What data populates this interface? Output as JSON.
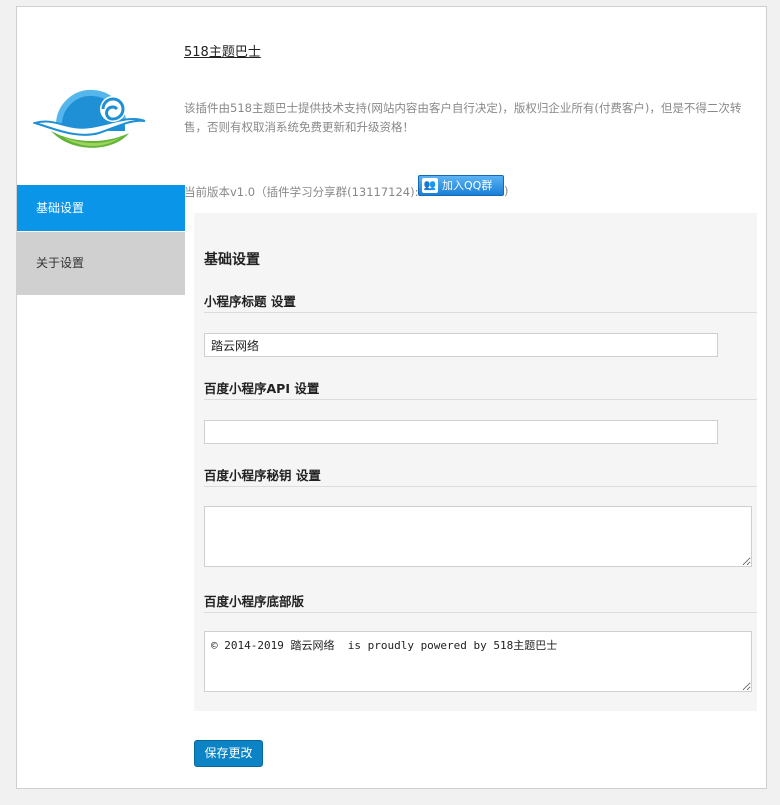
{
  "sidebar": {
    "items": [
      {
        "label": "基础设置",
        "active": true
      },
      {
        "label": "关于设置",
        "active": false
      }
    ]
  },
  "header": {
    "plugin_link": "518主题巴士",
    "notice": "该插件由518主题巴士提供技术支持(网站内容由客户自行决定)，版权归企业所有(付费客户)，但是不得二次转售，否则有权取消系统免费更新和升级资格！",
    "version_text": "当前版本v1.0（插件学习分享群(13117124):",
    "version_tail": ")",
    "qq_button": "加入QQ群"
  },
  "panel": {
    "title": "基础设置",
    "fields": [
      {
        "label": "小程序标题 设置",
        "value": "踏云网络"
      },
      {
        "label": "百度小程序API 设置",
        "value": ""
      },
      {
        "label": "百度小程序秘钥 设置",
        "value": ""
      },
      {
        "label": "百度小程序底部版",
        "value": "© 2014-2019 踏云网络  is proudly powered by 518主题巴士"
      }
    ]
  },
  "actions": {
    "save_label": "保存更改"
  },
  "colors": {
    "accent": "#0a95e8",
    "save_button": "#0b83c4",
    "inactive_nav": "#d0d0d0",
    "panel_bg": "#f5f5f5"
  }
}
